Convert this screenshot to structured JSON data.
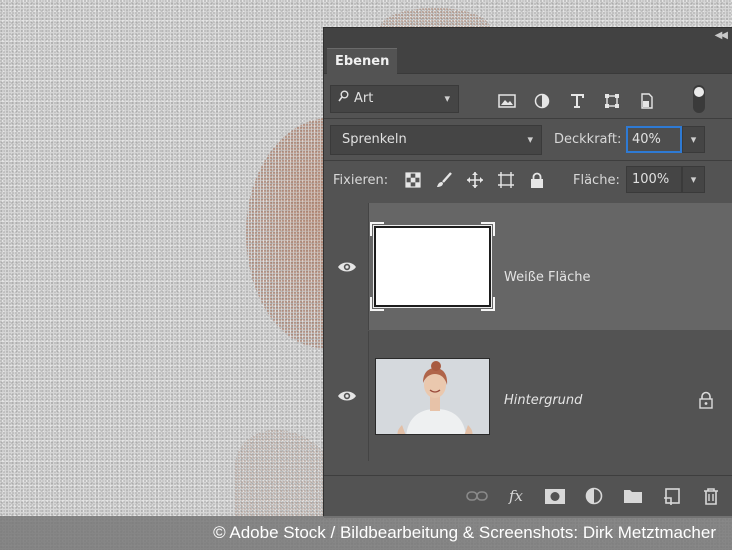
{
  "panel": {
    "tab_label": "Ebenen",
    "filter": {
      "value": "Art"
    },
    "blend_mode": {
      "value": "Sprenkeln"
    },
    "opacity": {
      "label": "Deckkraft:",
      "value": "40%"
    },
    "lock": {
      "label": "Fixieren:"
    },
    "fill": {
      "label": "Fläche:",
      "value": "100%"
    },
    "layers": [
      {
        "name": "Weiße Fläche",
        "visible": true,
        "selected": true,
        "locked": false,
        "thumbnail": "white"
      },
      {
        "name": "Hintergrund",
        "visible": true,
        "selected": false,
        "locked": true,
        "thumbnail": "photo"
      }
    ],
    "filter_icons": [
      "image-filter-icon",
      "adjustment-filter-icon",
      "type-filter-icon",
      "shape-filter-icon",
      "smartobject-filter-icon"
    ],
    "lock_icons": [
      "lock-transparent-pixels-icon",
      "lock-image-pixels-icon",
      "lock-position-icon",
      "lock-artboard-icon",
      "lock-all-icon"
    ],
    "bottom_icons": [
      "link-layers-icon",
      "fx-icon",
      "add-mask-icon",
      "new-adjustment-layer-icon",
      "new-group-icon",
      "new-layer-icon",
      "delete-layer-icon"
    ],
    "colors": {
      "panel_bg": "#535353",
      "selected_layer_bg": "#666666",
      "focus_border": "#2e7ad4"
    }
  },
  "credit": "© Adobe Stock / Bildbearbeitung & Screenshots: Dirk Metztmacher"
}
